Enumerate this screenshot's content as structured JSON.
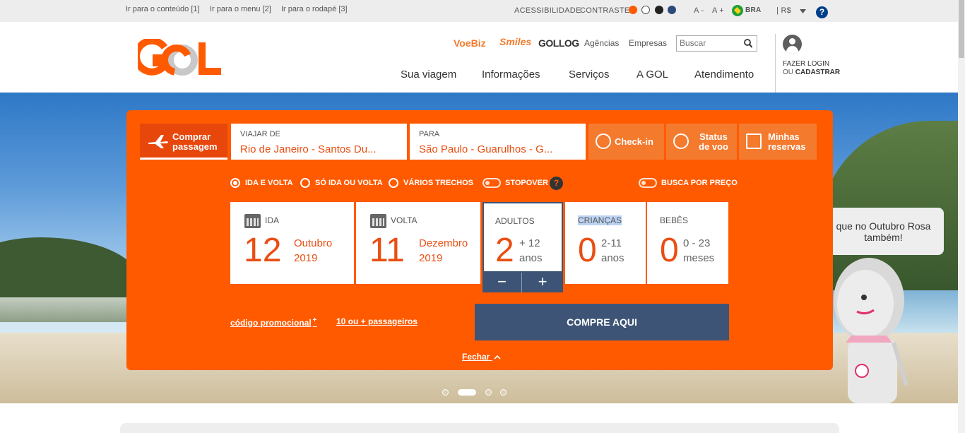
{
  "topbar": {
    "skip_links": [
      "Ir para o conteúdo [1]",
      "Ir para o menu [2]",
      "Ir para o rodapé [3]"
    ],
    "accessibility": "ACESSIBILIDADE",
    "contrast": "CONTRASTE",
    "contrast_colors": [
      "#ff5a00",
      "#ffffff",
      "#222222",
      "#2e4a7a"
    ],
    "font_decrease": "A -",
    "font_increase": "A +",
    "country": "BRA",
    "currency": "| R$",
    "help": "?"
  },
  "header": {
    "brands": [
      "VoeBiz",
      "Smiles",
      "GOLLOG"
    ],
    "brand_colors": [
      "#f47a2e",
      "#f47a2e",
      "#333333"
    ],
    "small_nav": [
      "Agências",
      "Empresas"
    ],
    "search_placeholder": "Buscar",
    "main_nav": [
      "Sua viagem",
      "Informações",
      "Serviços",
      "A GOL",
      "Atendimento"
    ],
    "login_line1": "FAZER LOGIN",
    "login_line2_prefix": "OU ",
    "login_line2_bold": "CADASTRAR"
  },
  "booking": {
    "tab_buy": "Comprar passagem",
    "origin_label": "VIAJAR DE",
    "origin_value": "Rio de Janeiro - Santos Du...",
    "dest_label": "PARA",
    "dest_value": "São Paulo - Guarulhos - G...",
    "quick": [
      "Check-in",
      "Status de voo",
      "Minhas reservas"
    ],
    "trip_types": [
      "IDA E VOLTA",
      "SÓ IDA OU VOLTA",
      "VÁRIOS TRECHOS"
    ],
    "selected_trip_type": "IDA E VOLTA",
    "stopover": "STOPOVER",
    "stopover_help": "?",
    "search_by_price": "BUSCA POR PREÇO",
    "depart": {
      "label": "IDA",
      "day": "12",
      "month": "Outubro",
      "year": "2019"
    },
    "return": {
      "label": "VOLTA",
      "day": "11",
      "month": "Dezembro",
      "year": "2019"
    },
    "adults": {
      "label": "ADULTOS",
      "count": "2",
      "range": "+ 12",
      "unit": "anos"
    },
    "children": {
      "label": "CRIANÇAS",
      "count": "0",
      "range": "2-11",
      "unit": "anos"
    },
    "infants": {
      "label": "BEBÊS",
      "count": "0",
      "range": "0 - 23",
      "unit": "meses"
    },
    "stepper_minus": "−",
    "stepper_plus": "+",
    "promo_link": "código promocional",
    "promo_plus": "+",
    "group_link": "10 ou + passageiros",
    "submit": "COMPRE AQUI",
    "close": "Fechar"
  },
  "banner": {
    "bubble_text": "que no Outubro Rosa também!"
  },
  "colors": {
    "brand_orange": "#ff5a00",
    "navy": "#3d5476"
  }
}
